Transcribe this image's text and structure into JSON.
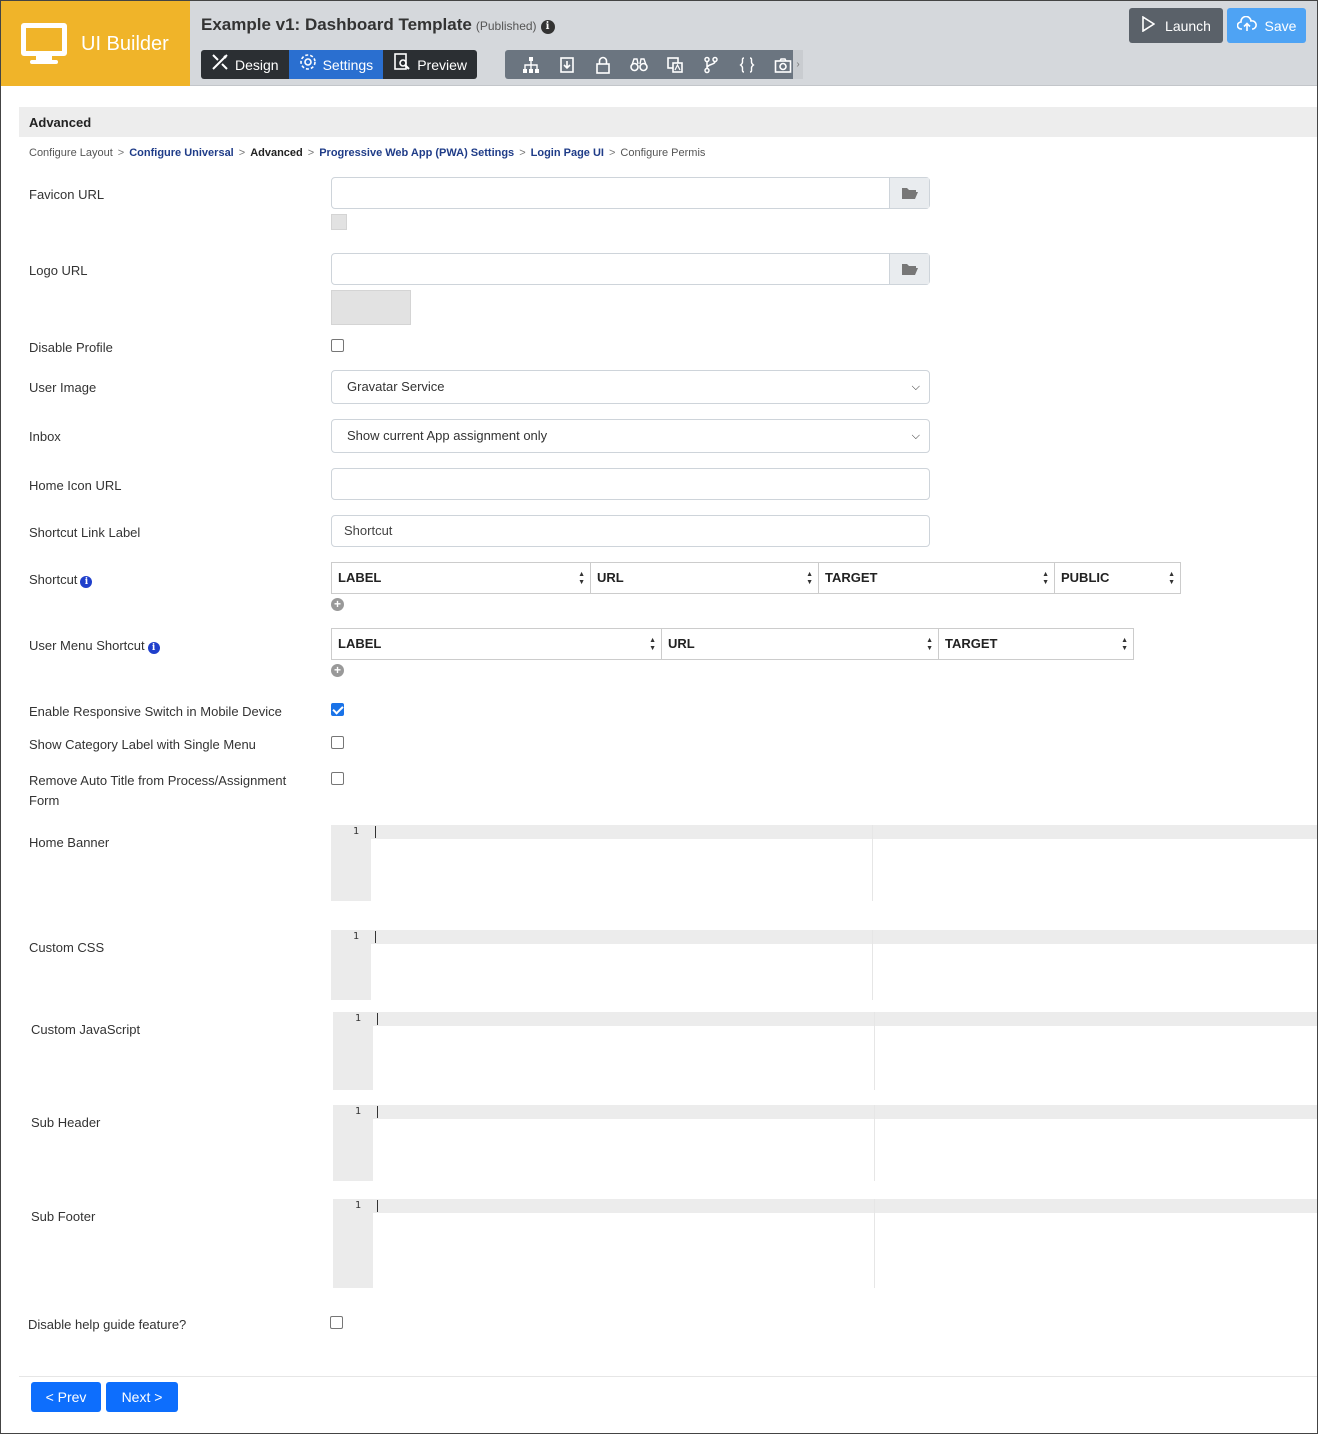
{
  "brand": {
    "name": "UI Builder",
    "icon": "monitor-icon",
    "color": "#f0b429"
  },
  "app": {
    "title": "Example v1: Dashboard Template",
    "status": "(Published)",
    "info_glyph": "i"
  },
  "modes": [
    {
      "label": "Design",
      "icon": "design-tools-icon"
    },
    {
      "label": "Settings",
      "icon": "gear-icon",
      "active": true
    },
    {
      "label": "Preview",
      "icon": "preview-icon"
    }
  ],
  "tools": [
    "sitemap-icon",
    "export-icon",
    "lock-icon",
    "binoculars-icon",
    "translate-icon",
    "branch-icon",
    "code-braces-icon",
    "camera-icon"
  ],
  "actions": {
    "launch": "Launch",
    "save": "Save"
  },
  "section": {
    "title": "Advanced"
  },
  "breadcrumb": [
    {
      "label": "Configure Layout",
      "type": "plain"
    },
    {
      "label": "Configure Universal",
      "type": "link"
    },
    {
      "label": "Advanced",
      "type": "current"
    },
    {
      "label": "Progressive Web App (PWA) Settings",
      "type": "link"
    },
    {
      "label": "Login Page UI",
      "type": "link"
    },
    {
      "label": "Configure Permissic",
      "type": "plain"
    }
  ],
  "breadcrumb_sep": ">",
  "fields": {
    "favicon_url": {
      "label": "Favicon URL",
      "value": ""
    },
    "logo_url": {
      "label": "Logo URL",
      "value": ""
    },
    "disable_profile": {
      "label": "Disable Profile",
      "checked": false
    },
    "user_image": {
      "label": "User Image",
      "selected": "Gravatar Service"
    },
    "inbox": {
      "label": "Inbox",
      "selected": "Show current App assignment only"
    },
    "home_icon_url": {
      "label": "Home Icon URL",
      "value": ""
    },
    "shortcut_link_label": {
      "label": "Shortcut Link Label",
      "value": "Shortcut"
    },
    "shortcut": {
      "label": "Shortcut",
      "columns": [
        "LABEL",
        "URL",
        "TARGET",
        "PUBLIC"
      ]
    },
    "user_menu_shortcut": {
      "label": "User Menu Shortcut",
      "columns": [
        "LABEL",
        "URL",
        "TARGET"
      ]
    },
    "responsive_switch": {
      "label": "Enable Responsive Switch in Mobile Device",
      "checked": true
    },
    "category_label": {
      "label": "Show Category Label with Single Menu",
      "checked": false
    },
    "remove_auto_title": {
      "label": "Remove Auto Title from Process/Assignment Form",
      "checked": false
    },
    "home_banner": {
      "label": "Home Banner",
      "line": "1"
    },
    "custom_css": {
      "label": "Custom CSS",
      "line": "1"
    },
    "custom_js": {
      "label": "Custom JavaScript",
      "line": "1"
    },
    "sub_header": {
      "label": "Sub Header",
      "line": "1"
    },
    "sub_footer": {
      "label": "Sub Footer",
      "line": "1"
    },
    "disable_help": {
      "label": "Disable help guide feature?",
      "checked": false
    }
  },
  "nav": {
    "prev": "< Prev",
    "next": "Next >"
  },
  "colors": {
    "accent": "#0d6efd",
    "active_tab": "#2a6fd0",
    "save": "#4ea3f4",
    "launch": "#5a6169"
  }
}
